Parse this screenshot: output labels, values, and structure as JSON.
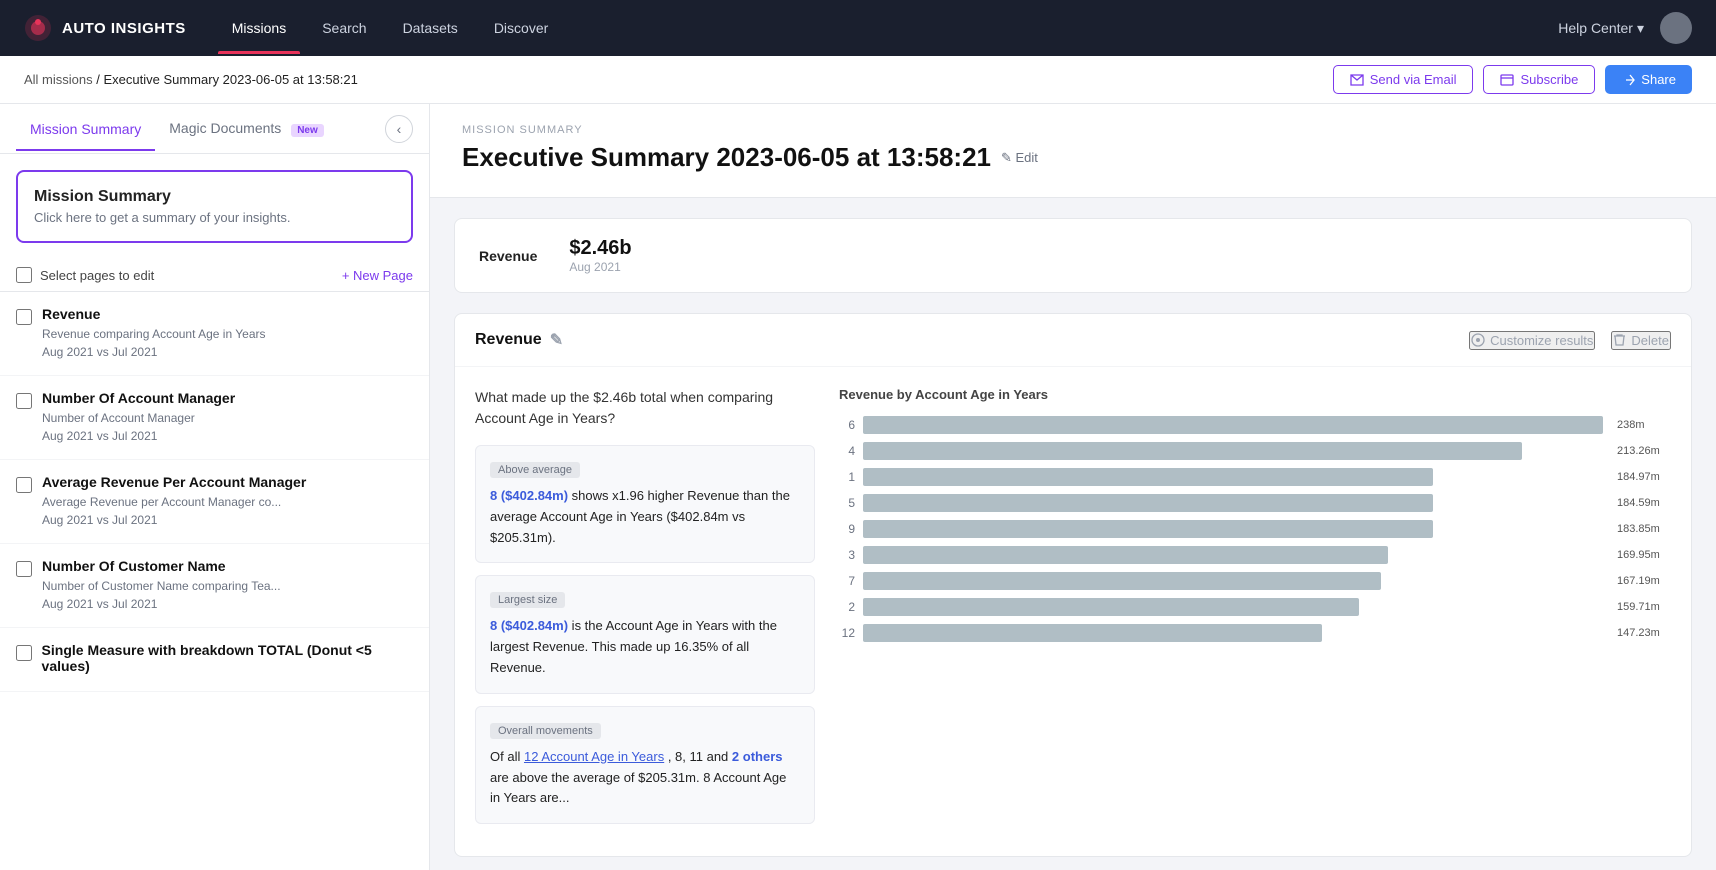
{
  "nav": {
    "logo_text": "AUTO INSIGHTS",
    "links": [
      {
        "label": "Missions",
        "active": true
      },
      {
        "label": "Search",
        "active": false
      },
      {
        "label": "Datasets",
        "active": false
      },
      {
        "label": "Discover",
        "active": false
      }
    ],
    "help_label": "Help Center",
    "help_chevron": "▾"
  },
  "breadcrumb": {
    "all_missions": "All missions",
    "separator": " / ",
    "current": "Executive Summary 2023-06-05 at 13:58:21"
  },
  "actions": {
    "send_email": "Send via Email",
    "subscribe": "Subscribe",
    "share": "Share"
  },
  "sidebar": {
    "tab_mission": "Mission Summary",
    "tab_magic": "Magic Documents",
    "badge_new": "New",
    "collapse_icon": "‹",
    "mission_card": {
      "title": "Mission Summary",
      "description": "Click here to get a summary of your insights."
    },
    "select_pages_label": "Select pages to edit",
    "new_page_label": "+ New Page",
    "pages": [
      {
        "title": "Revenue",
        "line1": "Revenue comparing Account Age in Years",
        "line2": "Aug 2021 vs Jul 2021"
      },
      {
        "title": "Number Of Account Manager",
        "line1": "Number of Account Manager",
        "line2": "Aug 2021 vs Jul 2021"
      },
      {
        "title": "Average Revenue Per Account Manager",
        "line1": "Average Revenue per Account Manager co...",
        "line2": "Aug 2021 vs Jul 2021"
      },
      {
        "title": "Number Of Customer Name",
        "line1": "Number of Customer Name comparing Tea...",
        "line2": "Aug 2021 vs Jul 2021"
      },
      {
        "title": "Single Measure with breakdown TOTAL (Donut <5 values)",
        "line1": "",
        "line2": ""
      }
    ]
  },
  "content": {
    "section_label": "MISSION SUMMARY",
    "title": "Executive Summary 2023-06-05 at 13:58:21",
    "edit_label": "✎ Edit",
    "stat": {
      "label": "Revenue",
      "value": "$2.46b",
      "period": "Aug 2021"
    },
    "revenue_section": {
      "title": "Revenue",
      "edit_icon": "✎",
      "customize": "Customize results",
      "delete": "Delete",
      "question": "What made up the $2.46b total when comparing Account Age in Years?",
      "insights": [
        {
          "tag": "Above average",
          "text": "8 ($402.84m) shows x1.96 higher Revenue than the average Account Age in Years ($402.84m vs $205.31m).",
          "highlight": "8 ($402.84m)"
        },
        {
          "tag": "Largest size",
          "text": "8 ($402.84m) is the Account Age in Years with the largest Revenue. This made up 16.35% of all Revenue.",
          "highlight": "8 ($402.84m)"
        },
        {
          "tag": "Overall movements",
          "text": "Of all 12 Account Age in Years , 8, 11 and 2 others are above the average of $205.31m. 8 Account Age in Years are...",
          "link": "12 Account Age in Years"
        }
      ],
      "chart_title": "Revenue by Account Age in Years",
      "chart_bars": [
        {
          "label": "6",
          "value": "238m",
          "pct": 100
        },
        {
          "label": "4",
          "value": "213.26m",
          "pct": 89
        },
        {
          "label": "1",
          "value": "184.97m",
          "pct": 77
        },
        {
          "label": "5",
          "value": "184.59m",
          "pct": 77
        },
        {
          "label": "9",
          "value": "183.85m",
          "pct": 77
        },
        {
          "label": "3",
          "value": "169.95m",
          "pct": 71
        },
        {
          "label": "7",
          "value": "167.19m",
          "pct": 70
        },
        {
          "label": "2",
          "value": "159.71m",
          "pct": 67
        },
        {
          "label": "12",
          "value": "147.23m",
          "pct": 62
        }
      ]
    }
  }
}
